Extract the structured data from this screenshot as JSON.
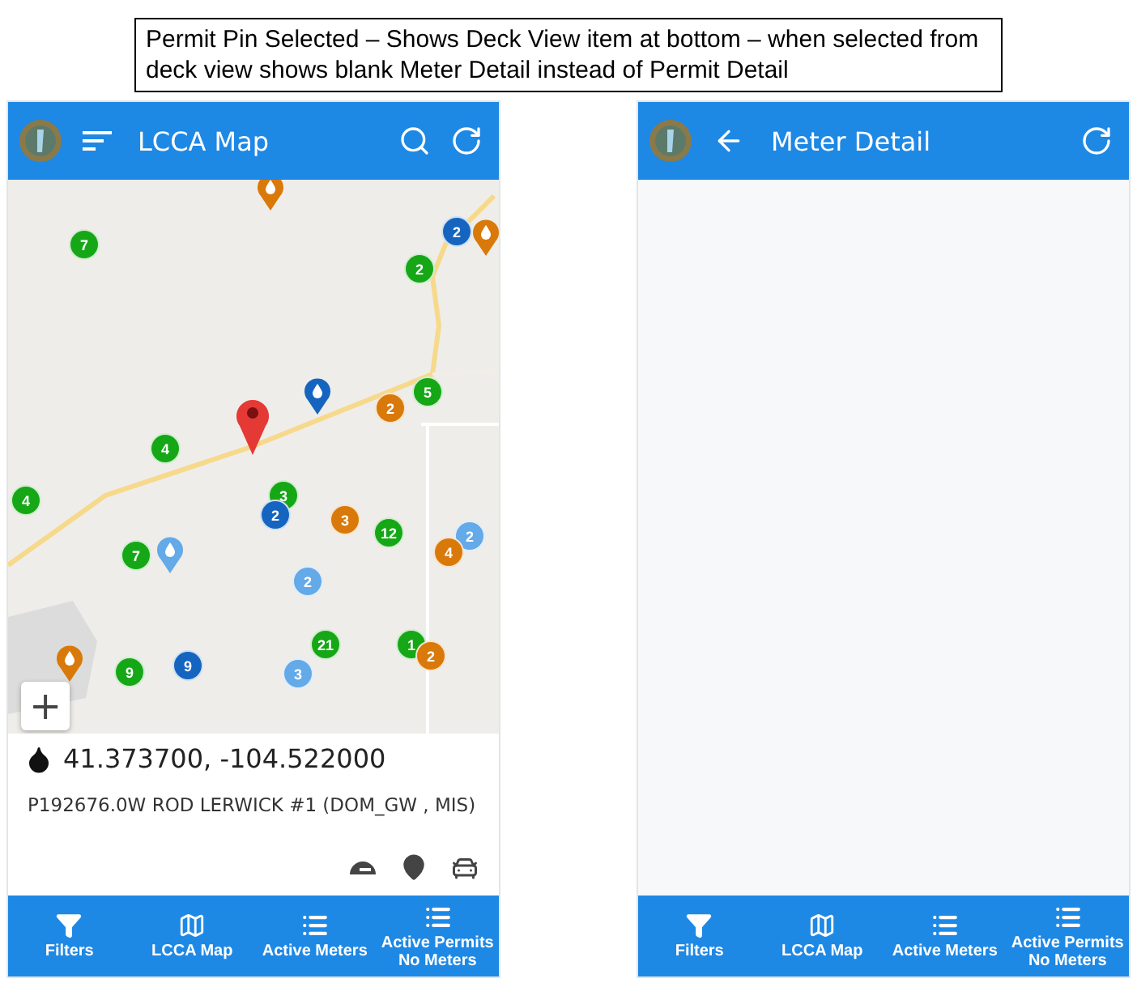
{
  "annotation": "Permit Pin Selected – Shows Deck View item at bottom – when selected from deck view shows blank Meter Detail instead of Permit Detail",
  "screens": [
    {
      "kind": "map",
      "header": {
        "title": "LCCA Map"
      },
      "map": {
        "markers": [
          {
            "kind": "pin",
            "color": "#d9790a"
          },
          {
            "kind": "cluster",
            "count": "7",
            "color": "#16a716"
          },
          {
            "kind": "cluster",
            "count": "2",
            "color": "#1565c0"
          },
          {
            "kind": "pin",
            "color": "#d9790a"
          },
          {
            "kind": "cluster",
            "count": "2",
            "color": "#16a716"
          },
          {
            "kind": "pin",
            "color": "#1565c0"
          },
          {
            "kind": "cluster",
            "count": "5",
            "color": "#16a716"
          },
          {
            "kind": "cluster",
            "count": "2",
            "color": "#d9790a"
          },
          {
            "kind": "selected",
            "color": "#e53935"
          },
          {
            "kind": "cluster",
            "count": "4",
            "color": "#16a716"
          },
          {
            "kind": "cluster",
            "count": "3",
            "color": "#16a716"
          },
          {
            "kind": "cluster",
            "count": "2",
            "color": "#1565c0"
          },
          {
            "kind": "cluster",
            "count": "3",
            "color": "#d9790a"
          },
          {
            "kind": "cluster",
            "count": "12",
            "color": "#16a716"
          },
          {
            "kind": "cluster",
            "count": "2",
            "color": "#64a9e8"
          },
          {
            "kind": "cluster",
            "count": "4",
            "color": "#d9790a"
          },
          {
            "kind": "cluster",
            "count": "4",
            "color": "#16a716"
          },
          {
            "kind": "cluster",
            "count": "7",
            "color": "#16a716"
          },
          {
            "kind": "pin",
            "color": "#64a9e8"
          },
          {
            "kind": "cluster",
            "count": "2",
            "color": "#64a9e8"
          },
          {
            "kind": "cluster",
            "count": "21",
            "color": "#16a716"
          },
          {
            "kind": "cluster",
            "count": "1",
            "color": "#16a716"
          },
          {
            "kind": "cluster",
            "count": "2",
            "color": "#d9790a"
          },
          {
            "kind": "pin",
            "color": "#d9790a"
          },
          {
            "kind": "cluster",
            "count": "9",
            "color": "#16a716"
          },
          {
            "kind": "cluster",
            "count": "9",
            "color": "#1565c0"
          },
          {
            "kind": "cluster",
            "count": "3",
            "color": "#64a9e8"
          }
        ],
        "zoom_in": "+"
      },
      "detail": {
        "coordinates": "41.373700, -104.522000",
        "permit": "P192676.0W ROD LERWICK #1 (DOM_GW , MIS)"
      },
      "nav": [
        {
          "label": "Filters"
        },
        {
          "label": "LCCA Map"
        },
        {
          "label": "Active Meters"
        },
        {
          "label": "Active Permits No Meters"
        }
      ]
    },
    {
      "kind": "detail",
      "header": {
        "title": "Meter Detail"
      },
      "nav": [
        {
          "label": "Filters"
        },
        {
          "label": "LCCA Map"
        },
        {
          "label": "Active Meters"
        },
        {
          "label": "Active Permits No Meters"
        }
      ]
    }
  ]
}
